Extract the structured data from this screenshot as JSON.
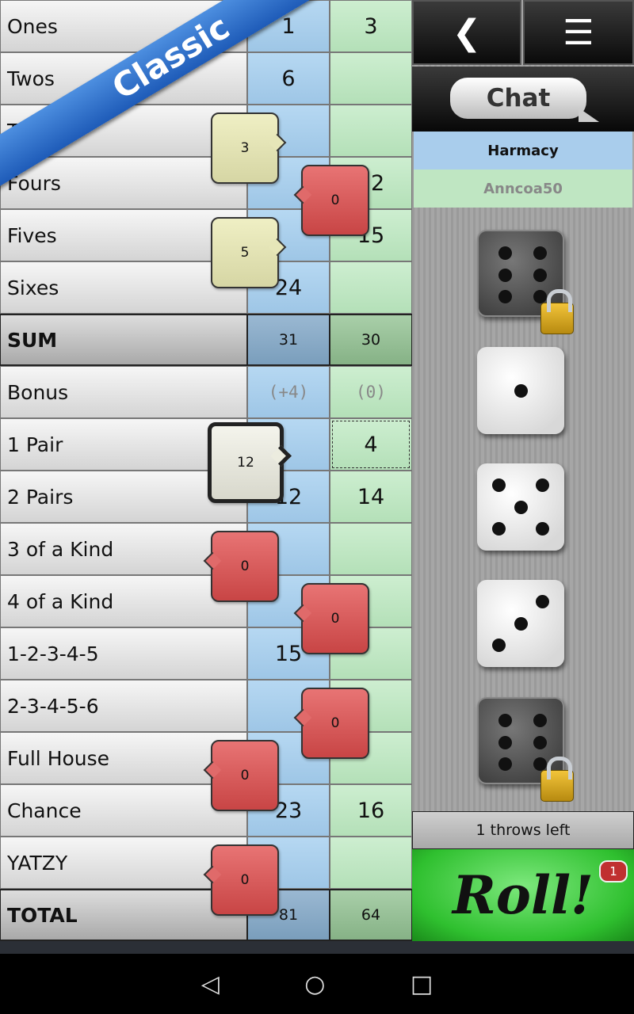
{
  "mode_ribbon": "Classic",
  "rows": [
    {
      "label": "Ones",
      "p1": "1",
      "p2": "3"
    },
    {
      "label": "Twos",
      "p1": "6",
      "p2": ""
    },
    {
      "label": "Threes",
      "p1": "",
      "p2": ""
    },
    {
      "label": "Fours",
      "p1": "",
      "p2": "12"
    },
    {
      "label": "Fives",
      "p1": "",
      "p2": "15"
    },
    {
      "label": "Sixes",
      "p1": "24",
      "p2": ""
    },
    {
      "label": "SUM",
      "p1": "31",
      "p2": "30"
    },
    {
      "label": "Bonus",
      "p1": "(+4)",
      "p2": "(0)"
    },
    {
      "label": "1 Pair",
      "p1": "",
      "p2": "4"
    },
    {
      "label": "2 Pairs",
      "p1": "12",
      "p2": "14"
    },
    {
      "label": "3 of a Kind",
      "p1": "",
      "p2": ""
    },
    {
      "label": "4 of a Kind",
      "p1": "",
      "p2": ""
    },
    {
      "label": "1-2-3-4-5",
      "p1": "15",
      "p2": ""
    },
    {
      "label": "2-3-4-5-6",
      "p1": "",
      "p2": ""
    },
    {
      "label": "Full House",
      "p1": "",
      "p2": ""
    },
    {
      "label": "Chance",
      "p1": "23",
      "p2": "16"
    },
    {
      "label": "YATZY",
      "p1": "",
      "p2": ""
    },
    {
      "label": "TOTAL",
      "p1": "81",
      "p2": "64"
    }
  ],
  "suggestions": [
    {
      "row": "Threes",
      "value": "3",
      "style": "yellow"
    },
    {
      "row": "Fours",
      "value": "0",
      "style": "red"
    },
    {
      "row": "Fives",
      "value": "5",
      "style": "yellow"
    },
    {
      "row": "1 Pair",
      "value": "12",
      "style": "selected"
    },
    {
      "row": "3 of a Kind",
      "value": "0",
      "style": "red"
    },
    {
      "row": "4 of a Kind",
      "value": "0",
      "style": "red"
    },
    {
      "row": "2-3-4-5-6",
      "value": "0",
      "style": "red"
    },
    {
      "row": "Full House",
      "value": "0",
      "style": "red"
    },
    {
      "row": "YATZY",
      "value": "0",
      "style": "red"
    }
  ],
  "panel": {
    "back_icon": "chevron-left-icon",
    "menu_icon": "list-menu-icon",
    "chat_label": "Chat",
    "player1": "Harmacy",
    "player2": "Anncoa50",
    "player1_color": "#a9cdec",
    "player2_color": "#bfe6c2",
    "dice": [
      {
        "value": 6,
        "locked": true
      },
      {
        "value": 1,
        "locked": false
      },
      {
        "value": 5,
        "locked": false
      },
      {
        "value": 3,
        "locked": false
      },
      {
        "value": 6,
        "locked": true
      }
    ],
    "throws_left": "1 throws left",
    "roll_label": "Roll!",
    "roll_badge": "1"
  },
  "nav": {
    "back": "◁",
    "home": "○",
    "recents": "□"
  }
}
